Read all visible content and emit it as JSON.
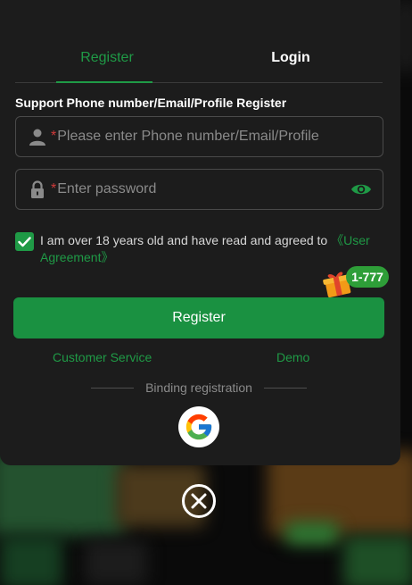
{
  "tabs": [
    {
      "label": "Register",
      "active": true
    },
    {
      "label": "Login",
      "active": false
    }
  ],
  "form": {
    "section_label": "Support Phone number/Email/Profile Register",
    "account": {
      "required_mark": "*",
      "placeholder": "Please enter Phone number/Email/Profile",
      "value": "",
      "icon": "user-icon"
    },
    "password": {
      "required_mark": "*",
      "placeholder": "Enter password",
      "value": "",
      "icon": "lock-icon",
      "toggle_icon": "eye-icon"
    }
  },
  "agreement": {
    "checked": true,
    "text": "I am over 18 years old and have read and agreed to",
    "link": "《User Agreement》"
  },
  "promo": {
    "badge": "1-777",
    "icon": "gift-icon"
  },
  "register_button": "Register",
  "links": {
    "customer_service": "Customer Service",
    "demo": "Demo"
  },
  "binding": {
    "label": "Binding registration",
    "providers": [
      "google"
    ]
  },
  "colors": {
    "accent": "#1f9a46",
    "button": "#1a9141",
    "modal_bg": "#1c1c1c",
    "required": "#d03a3a"
  }
}
